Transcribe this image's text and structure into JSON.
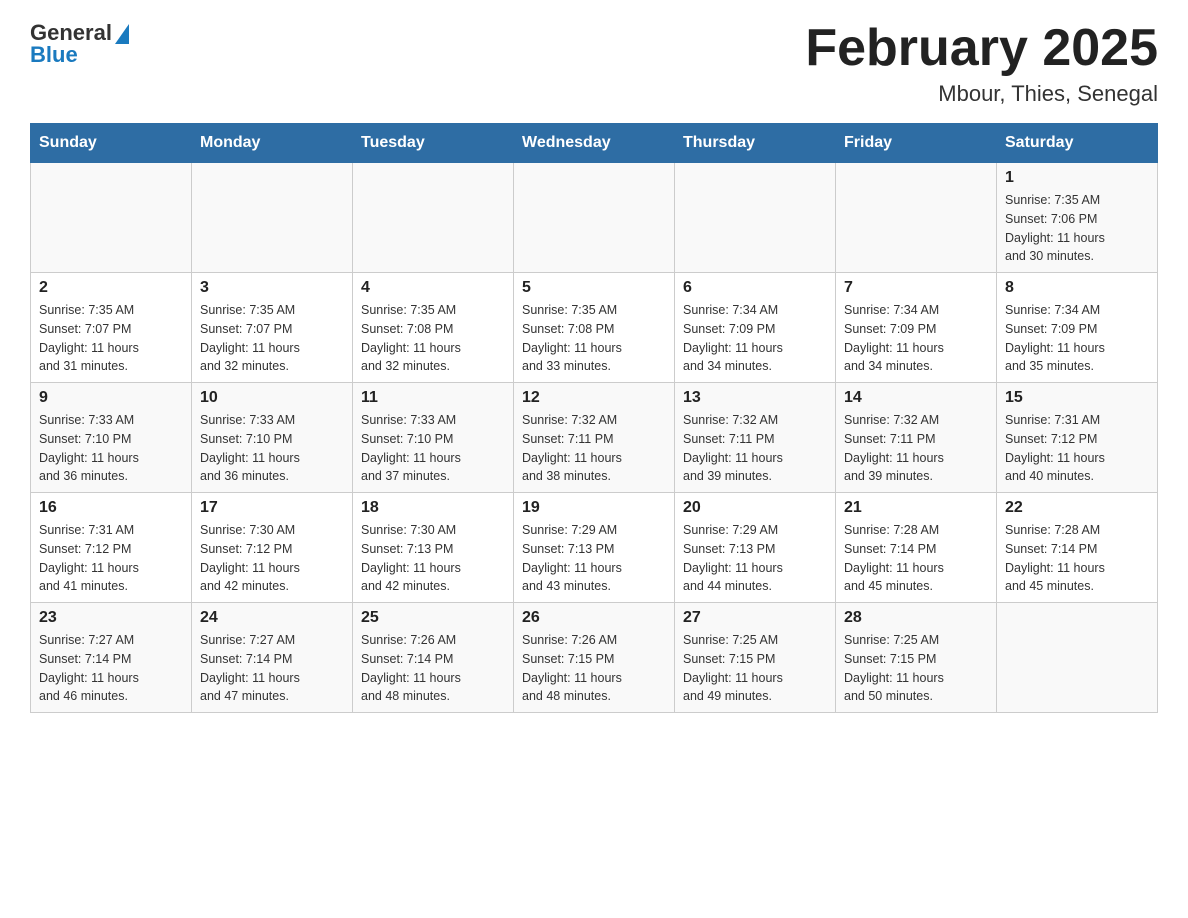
{
  "header": {
    "logo": {
      "general": "General",
      "blue": "Blue"
    },
    "title": "February 2025",
    "subtitle": "Mbour, Thies, Senegal"
  },
  "days_of_week": [
    "Sunday",
    "Monday",
    "Tuesday",
    "Wednesday",
    "Thursday",
    "Friday",
    "Saturday"
  ],
  "weeks": [
    {
      "row_class": "row-1",
      "days": [
        {
          "number": "",
          "info": ""
        },
        {
          "number": "",
          "info": ""
        },
        {
          "number": "",
          "info": ""
        },
        {
          "number": "",
          "info": ""
        },
        {
          "number": "",
          "info": ""
        },
        {
          "number": "",
          "info": ""
        },
        {
          "number": "1",
          "info": "Sunrise: 7:35 AM\nSunset: 7:06 PM\nDaylight: 11 hours\nand 30 minutes."
        }
      ]
    },
    {
      "row_class": "row-2",
      "days": [
        {
          "number": "2",
          "info": "Sunrise: 7:35 AM\nSunset: 7:07 PM\nDaylight: 11 hours\nand 31 minutes."
        },
        {
          "number": "3",
          "info": "Sunrise: 7:35 AM\nSunset: 7:07 PM\nDaylight: 11 hours\nand 32 minutes."
        },
        {
          "number": "4",
          "info": "Sunrise: 7:35 AM\nSunset: 7:08 PM\nDaylight: 11 hours\nand 32 minutes."
        },
        {
          "number": "5",
          "info": "Sunrise: 7:35 AM\nSunset: 7:08 PM\nDaylight: 11 hours\nand 33 minutes."
        },
        {
          "number": "6",
          "info": "Sunrise: 7:34 AM\nSunset: 7:09 PM\nDaylight: 11 hours\nand 34 minutes."
        },
        {
          "number": "7",
          "info": "Sunrise: 7:34 AM\nSunset: 7:09 PM\nDaylight: 11 hours\nand 34 minutes."
        },
        {
          "number": "8",
          "info": "Sunrise: 7:34 AM\nSunset: 7:09 PM\nDaylight: 11 hours\nand 35 minutes."
        }
      ]
    },
    {
      "row_class": "row-3",
      "days": [
        {
          "number": "9",
          "info": "Sunrise: 7:33 AM\nSunset: 7:10 PM\nDaylight: 11 hours\nand 36 minutes."
        },
        {
          "number": "10",
          "info": "Sunrise: 7:33 AM\nSunset: 7:10 PM\nDaylight: 11 hours\nand 36 minutes."
        },
        {
          "number": "11",
          "info": "Sunrise: 7:33 AM\nSunset: 7:10 PM\nDaylight: 11 hours\nand 37 minutes."
        },
        {
          "number": "12",
          "info": "Sunrise: 7:32 AM\nSunset: 7:11 PM\nDaylight: 11 hours\nand 38 minutes."
        },
        {
          "number": "13",
          "info": "Sunrise: 7:32 AM\nSunset: 7:11 PM\nDaylight: 11 hours\nand 39 minutes."
        },
        {
          "number": "14",
          "info": "Sunrise: 7:32 AM\nSunset: 7:11 PM\nDaylight: 11 hours\nand 39 minutes."
        },
        {
          "number": "15",
          "info": "Sunrise: 7:31 AM\nSunset: 7:12 PM\nDaylight: 11 hours\nand 40 minutes."
        }
      ]
    },
    {
      "row_class": "row-4",
      "days": [
        {
          "number": "16",
          "info": "Sunrise: 7:31 AM\nSunset: 7:12 PM\nDaylight: 11 hours\nand 41 minutes."
        },
        {
          "number": "17",
          "info": "Sunrise: 7:30 AM\nSunset: 7:12 PM\nDaylight: 11 hours\nand 42 minutes."
        },
        {
          "number": "18",
          "info": "Sunrise: 7:30 AM\nSunset: 7:13 PM\nDaylight: 11 hours\nand 42 minutes."
        },
        {
          "number": "19",
          "info": "Sunrise: 7:29 AM\nSunset: 7:13 PM\nDaylight: 11 hours\nand 43 minutes."
        },
        {
          "number": "20",
          "info": "Sunrise: 7:29 AM\nSunset: 7:13 PM\nDaylight: 11 hours\nand 44 minutes."
        },
        {
          "number": "21",
          "info": "Sunrise: 7:28 AM\nSunset: 7:14 PM\nDaylight: 11 hours\nand 45 minutes."
        },
        {
          "number": "22",
          "info": "Sunrise: 7:28 AM\nSunset: 7:14 PM\nDaylight: 11 hours\nand 45 minutes."
        }
      ]
    },
    {
      "row_class": "row-5",
      "days": [
        {
          "number": "23",
          "info": "Sunrise: 7:27 AM\nSunset: 7:14 PM\nDaylight: 11 hours\nand 46 minutes."
        },
        {
          "number": "24",
          "info": "Sunrise: 7:27 AM\nSunset: 7:14 PM\nDaylight: 11 hours\nand 47 minutes."
        },
        {
          "number": "25",
          "info": "Sunrise: 7:26 AM\nSunset: 7:14 PM\nDaylight: 11 hours\nand 48 minutes."
        },
        {
          "number": "26",
          "info": "Sunrise: 7:26 AM\nSunset: 7:15 PM\nDaylight: 11 hours\nand 48 minutes."
        },
        {
          "number": "27",
          "info": "Sunrise: 7:25 AM\nSunset: 7:15 PM\nDaylight: 11 hours\nand 49 minutes."
        },
        {
          "number": "28",
          "info": "Sunrise: 7:25 AM\nSunset: 7:15 PM\nDaylight: 11 hours\nand 50 minutes."
        },
        {
          "number": "",
          "info": ""
        }
      ]
    }
  ]
}
